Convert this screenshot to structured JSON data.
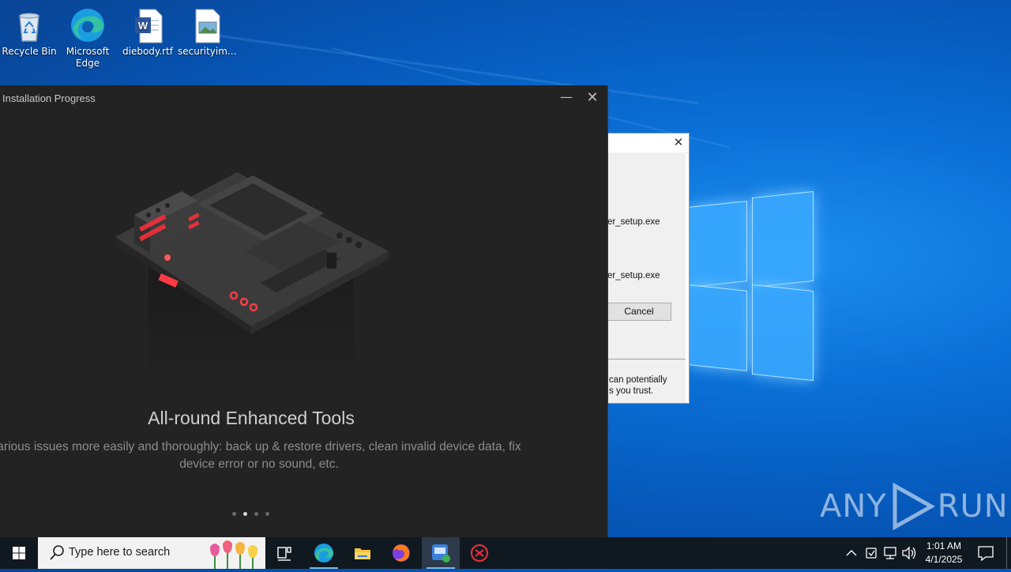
{
  "desktop": {
    "icons": [
      {
        "label": "Recycle Bin",
        "icon": "recycle-bin-icon"
      },
      {
        "label": "Microsoft Edge",
        "icon": "edge-icon"
      },
      {
        "label": "diebody.rtf",
        "icon": "word-document-icon"
      },
      {
        "label": "securityim...",
        "icon": "image-file-icon"
      }
    ]
  },
  "installer": {
    "title": "Installation Progress",
    "minimize_glyph": "—",
    "close_glyph": "✕",
    "headline": "All-round Enhanced Tools",
    "description_line1": "arious issues more easily and thoroughly: back up & restore drivers, clean invalid device data, fix",
    "description_line2": "device error or no sound, etc.",
    "carousel": {
      "total": 4,
      "active_index": 1
    }
  },
  "security_dialog": {
    "close_glyph": "✕",
    "line1": "er_setup.exe",
    "line2": "er_setup.exe",
    "cancel_label": "Cancel",
    "warning_line1": "can potentially",
    "warning_line2": "s you trust."
  },
  "watermark": {
    "text": "ANY",
    "text2": "RUN"
  },
  "taskbar": {
    "search_placeholder": "Type here to search",
    "apps": [
      "task-view-icon",
      "edge-icon",
      "file-explorer-icon",
      "firefox-icon",
      "installer-app-icon",
      "driver-tool-icon"
    ],
    "active_app": "installer-app-icon",
    "clock_time": "1:01 AM",
    "clock_date": "4/1/2025"
  },
  "colors": {
    "accent": "#76b9ed",
    "installer_bg": "#232323",
    "taskbar_bg": "#101820"
  }
}
